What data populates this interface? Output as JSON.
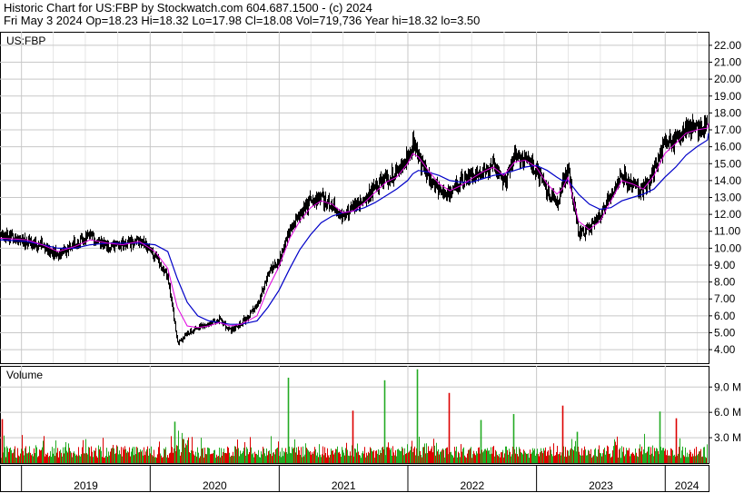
{
  "header": {
    "title": "Historic Chart for US:FBP by Stockwatch.com 604.687.1500 - (c) 2024",
    "quote": "Fri May  3 2024   Op=18.23   Hi=18.32   Lo=17.98   Cl=18.08   Vol=719,736   Year hi=18.32   lo=3.50"
  },
  "colors": {
    "price_bars": "#000000",
    "ma_short": "#e000e0",
    "ma_long": "#0000c8",
    "volume_up": "#22aa22",
    "volume_down": "#dd0000",
    "grid": "#c8c8c8"
  },
  "chart_data": [
    {
      "type": "line",
      "panel": "price",
      "label": "US:FBP",
      "x_kind": "date",
      "xlim": [
        "2018-11-01",
        "2024-05-03"
      ],
      "ylim": [
        3.2,
        22.8
      ],
      "y_ticks": [
        "22.00",
        "21.00",
        "20.00",
        "19.00",
        "18.00",
        "17.00",
        "16.00",
        "15.00",
        "14.00",
        "13.00",
        "12.00",
        "11.00",
        "10.00",
        "9.00",
        "8.00",
        "7.00",
        "6.00",
        "5.00",
        "4.00"
      ],
      "x": [
        "2018-11-01",
        "2019-01-15",
        "2019-03-01",
        "2019-04-15",
        "2019-06-01",
        "2019-07-15",
        "2019-09-01",
        "2019-10-15",
        "2019-12-01",
        "2020-01-15",
        "2020-02-20",
        "2020-03-18",
        "2020-04-15",
        "2020-05-15",
        "2020-06-15",
        "2020-07-15",
        "2020-08-15",
        "2020-09-15",
        "2020-10-30",
        "2020-11-30",
        "2020-12-31",
        "2021-01-31",
        "2021-02-28",
        "2021-03-31",
        "2021-04-30",
        "2021-05-31",
        "2021-06-30",
        "2021-07-31",
        "2021-08-31",
        "2021-09-30",
        "2021-10-31",
        "2021-11-30",
        "2021-12-31",
        "2022-01-15",
        "2022-01-31",
        "2022-02-28",
        "2022-03-31",
        "2022-04-30",
        "2022-05-31",
        "2022-06-30",
        "2022-07-31",
        "2022-08-31",
        "2022-09-30",
        "2022-10-31",
        "2022-11-30",
        "2022-12-31",
        "2023-01-31",
        "2023-02-28",
        "2023-03-15",
        "2023-03-31",
        "2023-04-30",
        "2023-05-31",
        "2023-06-30",
        "2023-07-31",
        "2023-08-31",
        "2023-09-30",
        "2023-10-31",
        "2023-11-30",
        "2023-12-31",
        "2024-01-31",
        "2024-02-29",
        "2024-03-31",
        "2024-04-30",
        "2024-05-03"
      ],
      "series": [
        {
          "role": "price_close",
          "values": [
            10.8,
            10.4,
            10.1,
            9.6,
            10.3,
            10.7,
            10.1,
            10.2,
            10.5,
            9.5,
            8.2,
            4.3,
            5.0,
            5.3,
            5.5,
            5.8,
            5.1,
            5.6,
            6.6,
            8.5,
            9.3,
            11.3,
            12.0,
            12.8,
            12.9,
            12.5,
            11.8,
            12.4,
            13.0,
            13.6,
            14.2,
            14.4,
            15.5,
            16.2,
            15.4,
            14.1,
            13.5,
            13.2,
            13.9,
            14.3,
            14.6,
            14.9,
            13.9,
            15.6,
            15.2,
            14.6,
            13.4,
            12.8,
            13.8,
            14.6,
            10.8,
            11.2,
            11.9,
            13.2,
            14.4,
            13.6,
            13.4,
            14.7,
            16.2,
            16.5,
            17.1,
            17.2,
            17.2,
            18.08
          ]
        },
        {
          "role": "ma_short",
          "values": [
            10.6,
            10.5,
            10.2,
            9.8,
            10.1,
            10.5,
            10.3,
            10.2,
            10.4,
            9.8,
            8.8,
            6.5,
            5.4,
            5.3,
            5.4,
            5.6,
            5.4,
            5.5,
            6.0,
            7.6,
            8.9,
            10.6,
            11.6,
            12.4,
            12.8,
            12.6,
            12.1,
            12.2,
            12.7,
            13.3,
            13.9,
            14.2,
            15.0,
            15.6,
            15.4,
            14.6,
            13.8,
            13.4,
            13.7,
            14.1,
            14.5,
            14.8,
            14.3,
            15.1,
            15.2,
            14.8,
            13.8,
            13.2,
            13.5,
            14.2,
            11.6,
            11.1,
            11.6,
            12.8,
            14.0,
            13.8,
            13.5,
            14.3,
            15.6,
            16.2,
            16.8,
            17.0,
            17.1,
            17.4
          ]
        },
        {
          "role": "ma_long",
          "values": [
            10.5,
            10.4,
            10.2,
            10.0,
            10.0,
            10.2,
            10.3,
            10.3,
            10.3,
            10.2,
            9.8,
            8.2,
            6.8,
            6.0,
            5.7,
            5.6,
            5.5,
            5.5,
            5.7,
            6.5,
            7.5,
            8.8,
            9.9,
            10.8,
            11.5,
            11.9,
            12.1,
            12.2,
            12.4,
            12.7,
            13.1,
            13.5,
            14.0,
            14.4,
            14.6,
            14.5,
            14.3,
            14.0,
            13.9,
            13.9,
            14.1,
            14.3,
            14.4,
            14.6,
            14.8,
            14.9,
            14.6,
            14.2,
            14.0,
            14.0,
            13.2,
            12.6,
            12.3,
            12.4,
            12.8,
            13.0,
            13.2,
            13.5,
            14.2,
            14.8,
            15.5,
            16.0,
            16.4,
            16.8
          ]
        }
      ]
    },
    {
      "type": "bar",
      "panel": "volume",
      "label": "Volume",
      "ylim": [
        0,
        11.5
      ],
      "y_unit": "M",
      "y_ticks": [
        "9.0 M",
        "6.0 M",
        "3.0 M"
      ],
      "x_tick_labels": [
        "2019",
        "2020",
        "2021",
        "2022",
        "2023",
        "2024"
      ],
      "notable_spikes": [
        {
          "x": "2018-11-05",
          "value": 5.2
        },
        {
          "x": "2020-03-10",
          "value": 4.9
        },
        {
          "x": "2021-01-26",
          "value": 10.1
        },
        {
          "x": "2021-07-27",
          "value": 6.2
        },
        {
          "x": "2021-10-26",
          "value": 9.8
        },
        {
          "x": "2022-01-26",
          "value": 11.1
        },
        {
          "x": "2022-04-27",
          "value": 8.3
        },
        {
          "x": "2022-07-27",
          "value": 5.1
        },
        {
          "x": "2022-10-26",
          "value": 5.8
        },
        {
          "x": "2023-03-14",
          "value": 6.8
        },
        {
          "x": "2023-04-26",
          "value": 3.7
        },
        {
          "x": "2023-12-15",
          "value": 6.1
        },
        {
          "x": "2024-02-01",
          "value": 5.3
        }
      ]
    }
  ]
}
